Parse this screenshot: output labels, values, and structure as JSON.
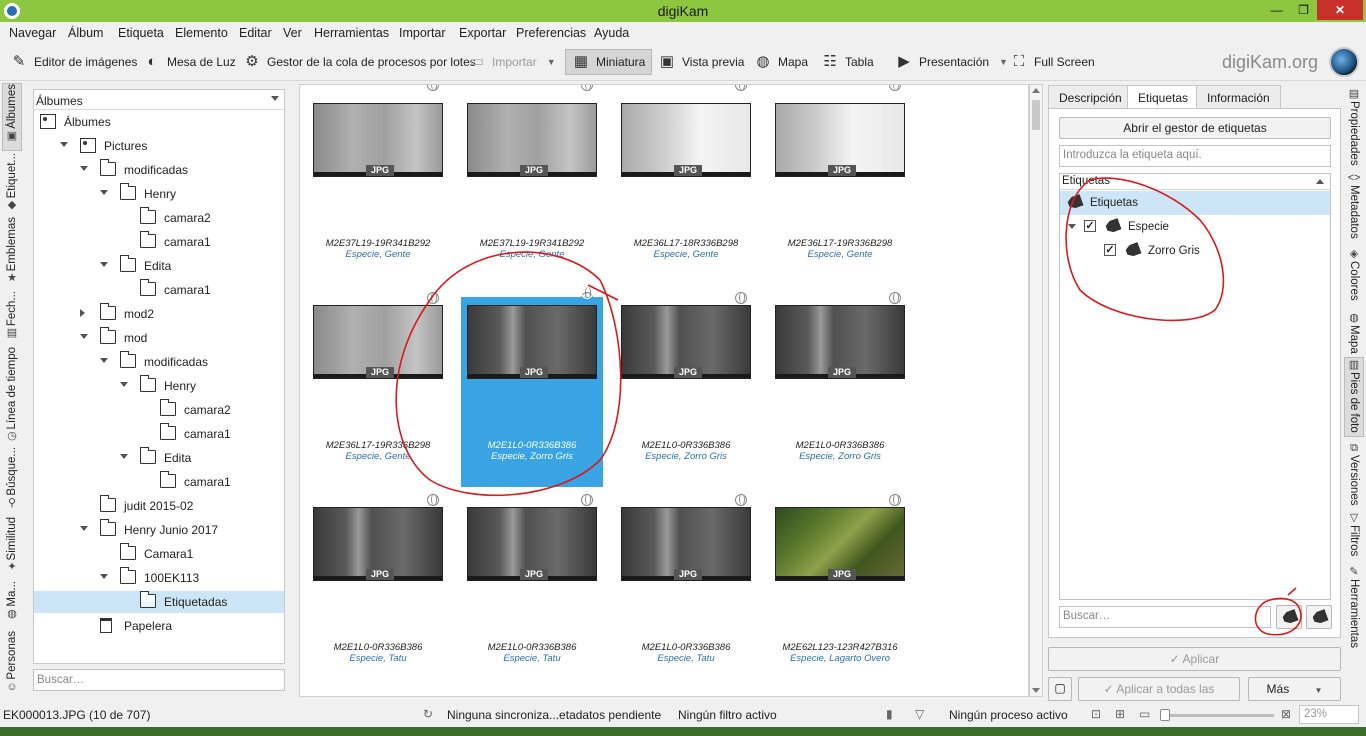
{
  "window": {
    "title": "digiKam",
    "min_glyph": "—",
    "max_glyph": "❐",
    "close_glyph": "✕"
  },
  "menu": [
    "Navegar",
    "Álbum",
    "Etiqueta",
    "Elemento",
    "Editar",
    "Ver",
    "Herramientas",
    "Importar",
    "Exportar",
    "Preferencias",
    "Ayuda"
  ],
  "toolbar": {
    "image_editor": "Editor de imágenes",
    "light_table": "Mesa de Luz",
    "batch_queue": "Gestor de la cola de procesos por lotes",
    "import": "Importar",
    "thumbnails": "Miniatura",
    "preview": "Vista previa",
    "map": "Mapa",
    "table": "Tabla",
    "slideshow": "Presentación",
    "fullscreen": "Full Screen",
    "brand": "digiKam.org"
  },
  "left_tabs": [
    "Álbumes",
    "Etiquet...",
    "Emblemas",
    "Fech...",
    "Línea de tiempo",
    "Búsque...",
    "Similitud",
    "Ma...",
    "Personas"
  ],
  "album_panel": {
    "header": "Álbumes",
    "search_placeholder": "Buscar…",
    "tree": [
      {
        "label": "Álbumes",
        "level": 0,
        "icon": "albums-icon",
        "arrow": ""
      },
      {
        "label": "Pictures",
        "level": 1,
        "icon": "pictures-icon",
        "arrow": "down"
      },
      {
        "label": "modificadas",
        "level": 2,
        "icon": "folder-icon",
        "arrow": "down"
      },
      {
        "label": "Henry",
        "level": 3,
        "icon": "folder-icon",
        "arrow": "down"
      },
      {
        "label": "camara2",
        "level": 4,
        "icon": "folder-icon",
        "arrow": ""
      },
      {
        "label": "camara1",
        "level": 4,
        "icon": "folder-icon",
        "arrow": ""
      },
      {
        "label": "Edita",
        "level": 3,
        "icon": "folder-icon",
        "arrow": "down"
      },
      {
        "label": "camara1",
        "level": 4,
        "icon": "folder-icon",
        "arrow": ""
      },
      {
        "label": "mod2",
        "level": 2,
        "icon": "folder-icon",
        "arrow": "right"
      },
      {
        "label": "mod",
        "level": 2,
        "icon": "folder-icon",
        "arrow": "down"
      },
      {
        "label": "modificadas",
        "level": 3,
        "icon": "folder-icon",
        "arrow": "down"
      },
      {
        "label": "Henry",
        "level": 4,
        "icon": "folder-icon",
        "arrow": "down"
      },
      {
        "label": "camara2",
        "level": 5,
        "icon": "folder-icon",
        "arrow": ""
      },
      {
        "label": "camara1",
        "level": 5,
        "icon": "folder-icon",
        "arrow": ""
      },
      {
        "label": "Edita",
        "level": 4,
        "icon": "folder-icon",
        "arrow": "down"
      },
      {
        "label": "camara1",
        "level": 5,
        "icon": "folder-icon",
        "arrow": ""
      },
      {
        "label": "judit 2015-02",
        "level": 2,
        "icon": "folder-icon",
        "arrow": ""
      },
      {
        "label": "Henry Junio 2017",
        "level": 2,
        "icon": "folder-icon",
        "arrow": "down"
      },
      {
        "label": "Camara1",
        "level": 3,
        "icon": "folder-icon",
        "arrow": ""
      },
      {
        "label": "100EK113",
        "level": 3,
        "icon": "folder-icon",
        "arrow": "down"
      },
      {
        "label": "Etiquetadas",
        "level": 4,
        "icon": "folder-icon",
        "arrow": "",
        "selected": true
      },
      {
        "label": "Papelera",
        "level": 2,
        "icon": "trash-icon",
        "arrow": ""
      }
    ]
  },
  "thumbnails": [
    {
      "name": "M2E37L19-19R341B292",
      "tags": "Especie, Gente",
      "style": "day",
      "badge": "JPG"
    },
    {
      "name": "M2E37L19-19R341B292",
      "tags": "Especie, Gente",
      "style": "day",
      "badge": "JPG"
    },
    {
      "name": "M2E36L17-18R336B298",
      "tags": "Especie, Gente",
      "style": "bright",
      "badge": "JPG"
    },
    {
      "name": "M2E36L17-19R336B298",
      "tags": "Especie, Gente",
      "style": "bright",
      "badge": "JPG"
    },
    {
      "name": "M2E36L17-19R336B298",
      "tags": "Especie, Gente",
      "style": "day",
      "badge": "JPG"
    },
    {
      "name": "M2E1L0-0R336B386",
      "tags": "Especie, Zorro Gris",
      "style": "night",
      "badge": "JPG",
      "selected": true
    },
    {
      "name": "M2E1L0-0R336B386",
      "tags": "Especie, Zorro Gris",
      "style": "night",
      "badge": "JPG"
    },
    {
      "name": "M2E1L0-0R336B386",
      "tags": "Especie, Zorro Gris",
      "style": "night",
      "badge": "JPG"
    },
    {
      "name": "M2E1L0-0R336B386",
      "tags": "Especie, Tatu",
      "style": "night",
      "badge": "JPG"
    },
    {
      "name": "M2E1L0-0R336B386",
      "tags": "Especie, Tatu",
      "style": "night",
      "badge": "JPG"
    },
    {
      "name": "M2E1L0-0R336B386",
      "tags": "Especie, Tatu",
      "style": "night",
      "badge": "JPG"
    },
    {
      "name": "M2E62L123-123R427B316",
      "tags": "Especie, Lagarto Overo",
      "style": "green",
      "badge": "JPG"
    }
  ],
  "right_panel": {
    "tabs": [
      "Descripción",
      "Etiquetas",
      "Información"
    ],
    "open_tag_manager": "Abrir el gestor de etiquetas",
    "tag_input_placeholder": "Introduzca la etiqueta aquí.",
    "tree_header": "Etiquetas",
    "tags": [
      {
        "label": "Etiquetas",
        "checked": false
      },
      {
        "label": "Especie",
        "checked": true
      },
      {
        "label": "Zorro Gris",
        "checked": true
      }
    ],
    "check_glyph": "✓",
    "search_placeholder": "Buscar…",
    "apply": "✓ Aplicar",
    "apply_all": "✓ Aplicar a todas las versiones",
    "more": "Más"
  },
  "right_tabs": [
    "Propiedades",
    "Metadatos",
    "Colores",
    "Mapa",
    "Pies de foto",
    "Versiones",
    "Filtros",
    "Herramientas"
  ],
  "status": {
    "file": "EK000013.JPG (10 de 707)",
    "sync": "Ninguna sincroniza...etadatos pendiente",
    "filter": "Ningún filtro activo",
    "process": "Ningún proceso activo",
    "zoom": "23%"
  },
  "colors": {
    "accent": "#8dc63f",
    "selection": "#3aa3e3",
    "annotation": "#d81b1b",
    "tag_link": "#2a6fb3"
  }
}
